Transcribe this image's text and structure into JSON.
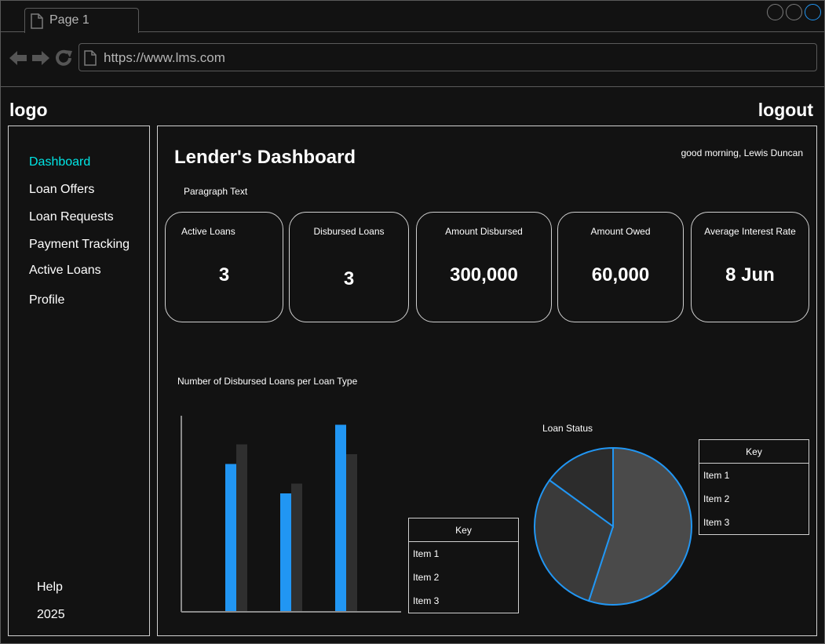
{
  "browser": {
    "tab_label": "Page 1",
    "url": "https://www.lms.com"
  },
  "header": {
    "logo": "logo",
    "logout": "logout"
  },
  "sidebar": {
    "items": [
      {
        "label": "Dashboard",
        "active": true
      },
      {
        "label": "Loan Offers"
      },
      {
        "label": "Loan Requests"
      },
      {
        "label": "Payment Tracking"
      },
      {
        "label": "Active Loans"
      },
      {
        "label": "Profile"
      }
    ],
    "help": "Help",
    "year": "2025"
  },
  "main": {
    "title": "Lender's Dashboard",
    "greeting": "good morning, Lewis Duncan",
    "paragraph": "Paragraph Text",
    "cards": [
      {
        "label": "Active Loans",
        "value": "3"
      },
      {
        "label": "Disbursed Loans",
        "value": "3"
      },
      {
        "label": "Amount Disbursed",
        "value": "300,000"
      },
      {
        "label": "Amount Owed",
        "value": "60,000"
      },
      {
        "label": "Average Interest Rate",
        "value": "8 Jun"
      }
    ]
  },
  "colors": {
    "accent": "#00e5e5",
    "series_primary": "#2196f3",
    "series_secondary": "#2f2f2f",
    "pie_fill_1": "#4a4a4a",
    "pie_fill_2": "#3a3a3a",
    "pie_fill_3": "#2c2c2c"
  },
  "chart_data": [
    {
      "type": "bar",
      "title": "Number of Disbursed Loans per Loan Type",
      "categories": [
        "",
        "",
        ""
      ],
      "series": [
        {
          "values": [
            7.5,
            6.0,
            9.5
          ]
        },
        {
          "values": [
            8.5,
            6.5,
            8.0
          ]
        }
      ],
      "ylim": [
        0,
        10
      ],
      "grid": false,
      "legend": {
        "title": "Key",
        "items": [
          "Item 1",
          "Item 2",
          "Item 3"
        ]
      }
    },
    {
      "type": "pie",
      "title": "Loan Status",
      "slices": [
        {
          "label": "Item 1",
          "value": 55
        },
        {
          "label": "Item 2",
          "value": 30
        },
        {
          "label": "Item 3",
          "value": 15
        }
      ],
      "legend": {
        "title": "Key",
        "items": [
          "Item 1",
          "Item 2",
          "Item 3"
        ]
      }
    }
  ]
}
